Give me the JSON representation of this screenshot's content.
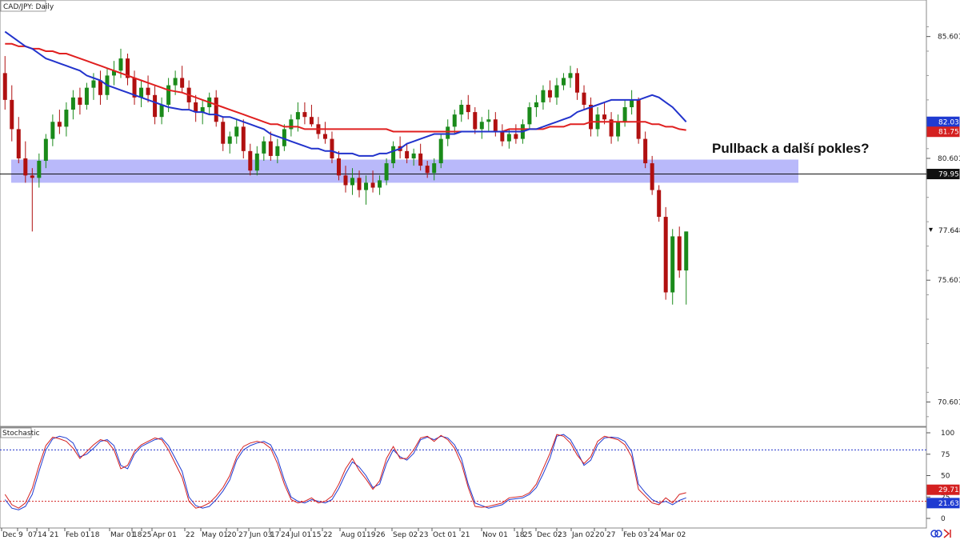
{
  "chart_data": [
    {
      "type": "candlestick",
      "title": "CAD/JPY: Daily",
      "annotation": "Pullback a další pokles?",
      "y_ticks": [
        "85.601",
        "80.601",
        "75.601",
        "70.601"
      ],
      "y_tick_values": [
        85.601,
        80.601,
        75.601,
        70.601
      ],
      "ylim": [
        69.6,
        87.1
      ],
      "x_ticks": [
        "Dec",
        "9",
        "07",
        "14",
        "21",
        "Feb 01",
        "18",
        "Mar 01",
        "18",
        "25",
        "Apr 01",
        "22",
        "May 01",
        "20",
        "27",
        "Jun 03",
        "17",
        "24",
        "Jul 01",
        "15",
        "22",
        "Aug 01",
        "19",
        "26",
        "Sep 02",
        "23",
        "Oct 01",
        "21",
        "Nov 01",
        "18",
        "25",
        "Dec 02",
        "23",
        "Jan 02",
        "20",
        "27",
        "Feb 03",
        "24",
        "Mar 02"
      ],
      "price_labels": {
        "ma_blue": {
          "value": "82.035",
          "color": "#1f3bd1"
        },
        "ma_red": {
          "value": "81.757",
          "color": "#d42020"
        },
        "support": {
          "value": "79.958",
          "color": "#111111"
        },
        "last": {
          "value": "77.648",
          "color": "#111111"
        }
      },
      "support_zone": [
        79.6,
        80.55
      ],
      "support_line": 79.958,
      "candles": [
        [
          84.1,
          84.8,
          82.6,
          83.0
        ],
        [
          83.0,
          83.6,
          81.3,
          81.8
        ],
        [
          81.8,
          82.3,
          80.4,
          80.6
        ],
        [
          80.6,
          81.3,
          79.6,
          79.9
        ],
        [
          79.9,
          80.2,
          77.6,
          79.8
        ],
        [
          79.8,
          80.8,
          79.4,
          80.5
        ],
        [
          80.5,
          81.6,
          80.2,
          81.4
        ],
        [
          81.4,
          82.4,
          81.1,
          82.1
        ],
        [
          82.1,
          82.6,
          81.6,
          81.9
        ],
        [
          81.9,
          82.9,
          81.5,
          82.6
        ],
        [
          82.6,
          83.4,
          82.2,
          83.1
        ],
        [
          83.1,
          83.5,
          82.4,
          82.8
        ],
        [
          82.8,
          83.7,
          82.6,
          83.5
        ],
        [
          83.5,
          84.1,
          83.0,
          83.8
        ],
        [
          83.8,
          84.2,
          82.8,
          83.2
        ],
        [
          83.2,
          84.3,
          83.0,
          84.0
        ],
        [
          84.0,
          84.6,
          83.6,
          84.2
        ],
        [
          84.2,
          85.1,
          83.9,
          84.7
        ],
        [
          84.7,
          84.9,
          83.6,
          83.9
        ],
        [
          83.9,
          84.2,
          82.8,
          83.1
        ],
        [
          83.1,
          83.8,
          82.7,
          83.5
        ],
        [
          83.5,
          84.0,
          82.9,
          83.2
        ],
        [
          83.2,
          83.6,
          82.0,
          82.3
        ],
        [
          82.3,
          83.1,
          82.0,
          82.8
        ],
        [
          82.8,
          83.9,
          82.5,
          83.6
        ],
        [
          83.6,
          84.2,
          83.2,
          83.9
        ],
        [
          83.9,
          84.4,
          83.3,
          83.5
        ],
        [
          83.5,
          83.8,
          82.6,
          82.9
        ],
        [
          82.9,
          83.2,
          82.1,
          82.5
        ],
        [
          82.5,
          83.0,
          82.0,
          82.7
        ],
        [
          82.7,
          83.3,
          82.4,
          83.1
        ],
        [
          83.1,
          83.4,
          81.9,
          82.1
        ],
        [
          82.1,
          82.3,
          80.9,
          81.2
        ],
        [
          81.2,
          81.7,
          80.8,
          81.5
        ],
        [
          81.5,
          82.2,
          81.2,
          81.9
        ],
        [
          81.9,
          82.2,
          80.6,
          80.9
        ],
        [
          80.9,
          81.2,
          79.9,
          80.1
        ],
        [
          80.1,
          81.1,
          79.9,
          80.8
        ],
        [
          80.8,
          81.5,
          80.5,
          81.3
        ],
        [
          81.3,
          81.7,
          80.5,
          80.7
        ],
        [
          80.7,
          81.4,
          80.4,
          81.1
        ],
        [
          81.1,
          82.0,
          80.9,
          81.8
        ],
        [
          81.8,
          82.4,
          81.5,
          82.2
        ],
        [
          82.2,
          82.9,
          81.7,
          82.5
        ],
        [
          82.5,
          82.9,
          82.0,
          82.3
        ],
        [
          82.3,
          82.8,
          81.9,
          82.0
        ],
        [
          82.0,
          82.3,
          81.4,
          81.6
        ],
        [
          81.6,
          82.1,
          81.2,
          81.4
        ],
        [
          81.4,
          81.7,
          80.4,
          80.6
        ],
        [
          80.6,
          80.9,
          79.7,
          79.9
        ],
        [
          79.9,
          80.3,
          79.2,
          79.5
        ],
        [
          79.5,
          80.2,
          79.1,
          79.8
        ],
        [
          79.8,
          80.1,
          79.0,
          79.3
        ],
        [
          79.3,
          79.9,
          78.7,
          79.6
        ],
        [
          79.6,
          80.1,
          79.2,
          79.4
        ],
        [
          79.4,
          79.9,
          79.1,
          79.7
        ],
        [
          79.7,
          80.6,
          79.5,
          80.4
        ],
        [
          80.4,
          81.3,
          80.2,
          81.1
        ],
        [
          81.1,
          81.5,
          80.6,
          80.9
        ],
        [
          80.9,
          81.2,
          80.4,
          80.6
        ],
        [
          80.6,
          81.0,
          80.3,
          80.8
        ],
        [
          80.8,
          81.2,
          80.1,
          80.3
        ],
        [
          80.3,
          80.5,
          79.8,
          80.0
        ],
        [
          80.0,
          80.6,
          79.7,
          80.4
        ],
        [
          80.4,
          81.6,
          80.2,
          81.4
        ],
        [
          81.4,
          82.2,
          81.1,
          81.9
        ],
        [
          81.9,
          82.6,
          81.6,
          82.4
        ],
        [
          82.4,
          83.0,
          82.1,
          82.8
        ],
        [
          82.8,
          83.2,
          82.2,
          82.5
        ],
        [
          82.5,
          82.7,
          81.6,
          81.8
        ],
        [
          81.8,
          82.3,
          81.4,
          82.1
        ],
        [
          82.1,
          82.6,
          81.7,
          82.2
        ],
        [
          82.2,
          82.5,
          81.5,
          81.7
        ],
        [
          81.7,
          82.0,
          81.1,
          81.3
        ],
        [
          81.3,
          81.8,
          81.0,
          81.6
        ],
        [
          81.6,
          82.0,
          81.2,
          81.4
        ],
        [
          81.4,
          82.2,
          81.2,
          82.0
        ],
        [
          82.0,
          82.9,
          81.8,
          82.7
        ],
        [
          82.7,
          83.2,
          82.3,
          82.9
        ],
        [
          82.9,
          83.6,
          82.6,
          83.4
        ],
        [
          83.4,
          83.8,
          82.9,
          83.1
        ],
        [
          83.1,
          83.9,
          82.8,
          83.6
        ],
        [
          83.6,
          84.1,
          83.4,
          83.9
        ],
        [
          83.9,
          84.4,
          83.5,
          84.1
        ],
        [
          84.1,
          84.3,
          83.0,
          83.3
        ],
        [
          83.3,
          83.6,
          82.6,
          82.8
        ],
        [
          82.8,
          83.1,
          81.5,
          81.8
        ],
        [
          81.8,
          82.7,
          81.5,
          82.4
        ],
        [
          82.4,
          82.9,
          82.0,
          82.2
        ],
        [
          82.2,
          82.5,
          81.2,
          81.5
        ],
        [
          81.5,
          82.4,
          81.3,
          82.1
        ],
        [
          82.1,
          83.0,
          81.9,
          82.7
        ],
        [
          82.7,
          83.4,
          82.4,
          83.0
        ],
        [
          83.0,
          83.1,
          81.2,
          81.4
        ],
        [
          81.4,
          81.7,
          80.2,
          80.4
        ],
        [
          80.4,
          80.7,
          79.1,
          79.3
        ],
        [
          79.3,
          79.5,
          78.0,
          78.2
        ],
        [
          78.2,
          78.6,
          74.8,
          75.1
        ],
        [
          75.1,
          77.7,
          74.6,
          77.4
        ],
        [
          77.4,
          77.8,
          75.7,
          76.0
        ],
        [
          76.0,
          77.6,
          74.6,
          77.6
        ]
      ],
      "ma_blue": [
        85.8,
        85.6,
        85.4,
        85.2,
        85.1,
        84.9,
        84.7,
        84.6,
        84.5,
        84.4,
        84.3,
        84.2,
        84.0,
        83.9,
        83.8,
        83.6,
        83.5,
        83.4,
        83.3,
        83.2,
        83.1,
        83.0,
        82.9,
        82.8,
        82.7,
        82.6,
        82.6,
        82.5,
        82.5,
        82.4,
        82.4,
        82.3,
        82.3,
        82.2,
        82.1,
        82.0,
        81.9,
        81.8,
        81.6,
        81.5,
        81.4,
        81.3,
        81.2,
        81.1,
        81.0,
        81.0,
        80.9,
        80.9,
        80.8,
        80.8,
        80.8,
        80.7,
        80.7,
        80.7,
        80.8,
        80.8,
        80.9,
        81.0,
        81.2,
        81.3,
        81.4,
        81.5,
        81.6,
        81.6,
        81.6,
        81.6,
        81.7,
        81.7,
        81.7,
        81.7,
        81.7,
        81.7,
        81.7,
        81.7,
        81.7,
        81.8,
        81.8,
        81.9,
        82.0,
        82.1,
        82.2,
        82.3,
        82.5,
        82.6,
        82.7,
        82.8,
        82.9,
        83.0,
        83.0,
        83.0,
        83.0,
        83.0,
        83.1,
        83.2,
        83.1,
        82.9,
        82.7,
        82.4,
        82.1
      ],
      "ma_red": [
        85.3,
        85.3,
        85.2,
        85.2,
        85.1,
        85.1,
        85.0,
        85.0,
        84.9,
        84.9,
        84.8,
        84.7,
        84.6,
        84.5,
        84.4,
        84.3,
        84.2,
        84.1,
        84.0,
        83.9,
        83.8,
        83.7,
        83.6,
        83.5,
        83.4,
        83.3,
        83.2,
        83.1,
        83.0,
        82.9,
        82.8,
        82.7,
        82.6,
        82.5,
        82.4,
        82.3,
        82.2,
        82.1,
        82.0,
        82.0,
        81.9,
        81.9,
        81.9,
        81.8,
        81.8,
        81.8,
        81.8,
        81.8,
        81.8,
        81.8,
        81.8,
        81.8,
        81.8,
        81.8,
        81.8,
        81.8,
        81.7,
        81.7,
        81.7,
        81.7,
        81.7,
        81.7,
        81.7,
        81.7,
        81.7,
        81.7,
        81.7,
        81.7,
        81.7,
        81.7,
        81.7,
        81.7,
        81.7,
        81.8,
        81.8,
        81.8,
        81.8,
        81.8,
        81.9,
        81.9,
        81.9,
        82.0,
        82.0,
        82.0,
        82.1,
        82.1,
        82.1,
        82.1,
        82.1,
        82.1,
        82.1,
        82.1,
        82.1,
        82.0,
        82.0,
        81.9,
        81.9,
        81.8,
        81.76
      ]
    },
    {
      "type": "line",
      "title": "Stochastic",
      "y_ticks": [
        "100",
        "75",
        "50",
        "25",
        "0"
      ],
      "y_tick_values": [
        100,
        75,
        50,
        25,
        0
      ],
      "ylim": [
        0,
        100
      ],
      "levels": [
        80,
        20
      ],
      "price_labels": {
        "k": {
          "value": "29.71",
          "color": "#d42020"
        },
        "d": {
          "value": "21.63",
          "color": "#1f3bd1"
        }
      },
      "series": [
        {
          "color": "#1f3bd1",
          "values": [
            22,
            12,
            10,
            14,
            28,
            55,
            80,
            93,
            96,
            94,
            88,
            72,
            75,
            82,
            90,
            92,
            85,
            62,
            58,
            75,
            84,
            88,
            92,
            94,
            85,
            55,
            25,
            15,
            12,
            14,
            22,
            32,
            45,
            68,
            80,
            85,
            88,
            90,
            86,
            70,
            45,
            25,
            20,
            18,
            22,
            20,
            18,
            22,
            35,
            52,
            66,
            60,
            50,
            36,
            40,
            64,
            80,
            72,
            68,
            76,
            92,
            95,
            92,
            96,
            94,
            86,
            70,
            40,
            18,
            15,
            12,
            14,
            16,
            22,
            24,
            28,
            36,
            52,
            70,
            96,
            98,
            92,
            78,
            62,
            68,
            86,
            94,
            95,
            94,
            90,
            78,
            40,
            30,
            22,
            18,
            20,
            16,
            21,
            24
          ]
        },
        {
          "color": "#d42020",
          "values": [
            28,
            16,
            12,
            18,
            35,
            62,
            85,
            95,
            93,
            90,
            82,
            70,
            78,
            86,
            92,
            90,
            80,
            58,
            62,
            78,
            86,
            90,
            94,
            92,
            80,
            48,
            20,
            12,
            14,
            18,
            26,
            36,
            50,
            72,
            84,
            88,
            90,
            88,
            82,
            64,
            40,
            22,
            18,
            20,
            24,
            18,
            20,
            26,
            40,
            58,
            70,
            56,
            46,
            34,
            44,
            70,
            84,
            70,
            70,
            80,
            94,
            96,
            90,
            97,
            92,
            82,
            64,
            36,
            14,
            13,
            14,
            16,
            18,
            24,
            26,
            30,
            40,
            58,
            76,
            98,
            96,
            88,
            74,
            64,
            72,
            90,
            96,
            94,
            92,
            86,
            72,
            34,
            26,
            18,
            16,
            24,
            18,
            28,
            30
          ]
        }
      ]
    }
  ]
}
